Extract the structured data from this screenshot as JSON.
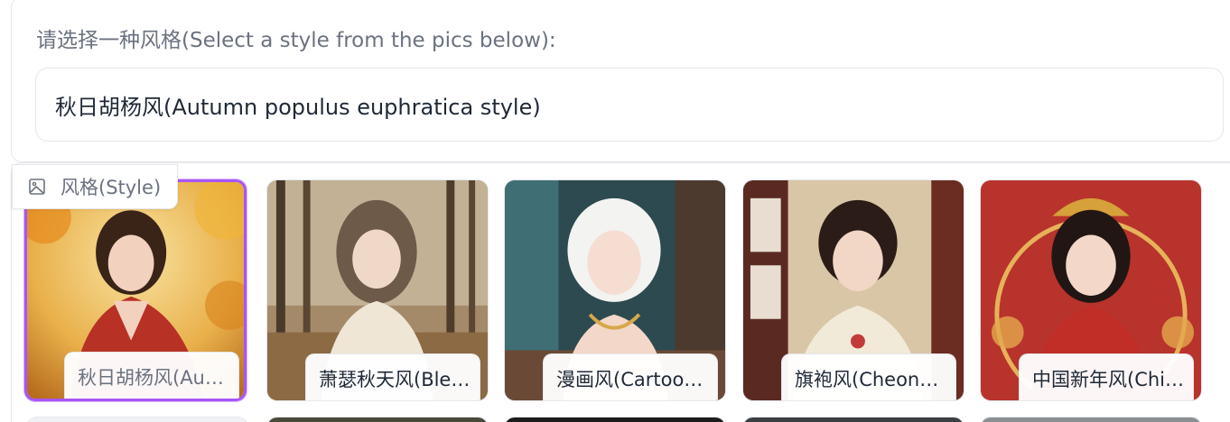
{
  "dropdown": {
    "label": "请选择一种风格(Select a style from the pics below):",
    "value": "秋日胡杨风(Autumn populus euphratica style)"
  },
  "gallery": {
    "tag_label": "风格(Style)",
    "tag_icon": "image-icon",
    "selected_index": 0,
    "accent_color": "#a855f7",
    "items": [
      {
        "caption": "秋日胡杨风(Autumn populus euphratica style)"
      },
      {
        "caption": "萧瑟秋天风(Bleak autumn style)"
      },
      {
        "caption": "漫画风(Cartoon style)"
      },
      {
        "caption": "旗袍风(Cheongsam style)"
      },
      {
        "caption": "中国新年风(Chinese New Year style)"
      }
    ]
  }
}
